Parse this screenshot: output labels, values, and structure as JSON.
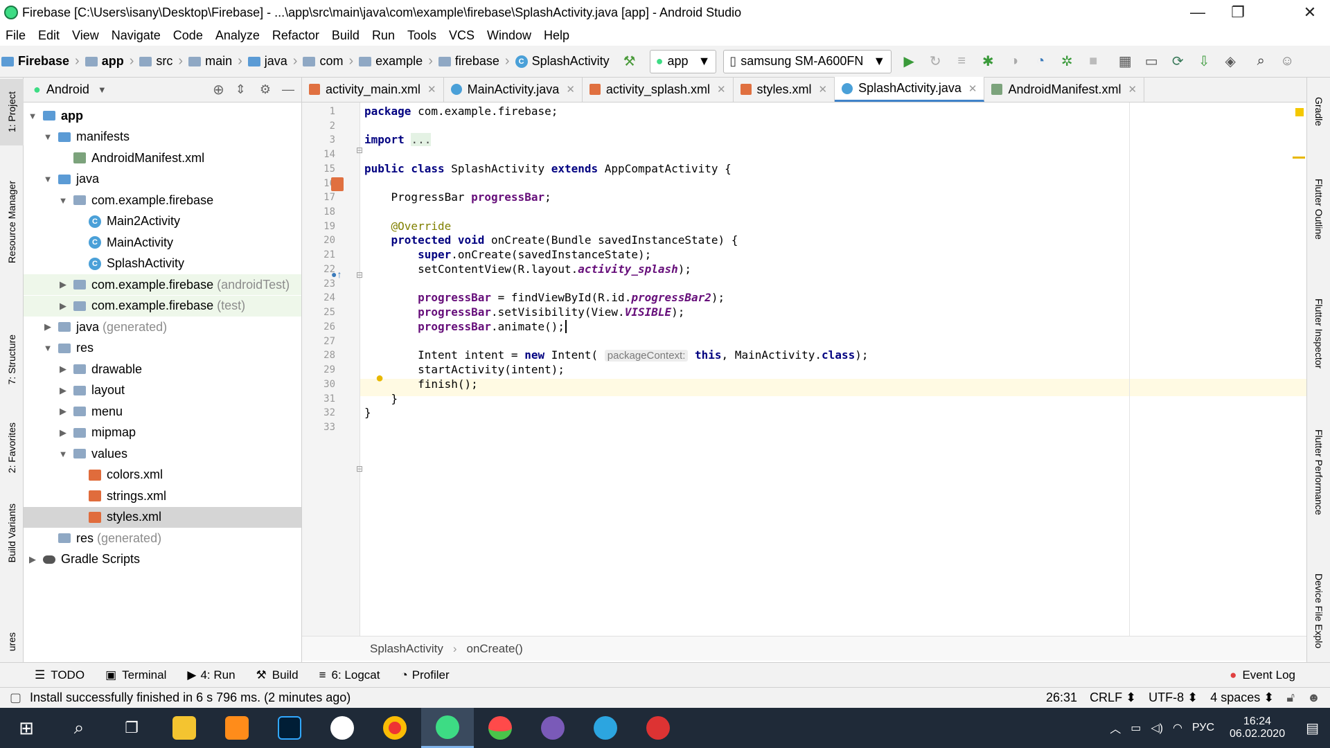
{
  "window": {
    "title": "Firebase [C:\\Users\\isany\\Desktop\\Firebase] - ...\\app\\src\\main\\java\\com\\example\\firebase\\SplashActivity.java [app] - Android Studio",
    "minimize": "—",
    "restore": "❐",
    "close": "✕"
  },
  "menu": [
    "File",
    "Edit",
    "View",
    "Navigate",
    "Code",
    "Analyze",
    "Refactor",
    "Build",
    "Run",
    "Tools",
    "VCS",
    "Window",
    "Help"
  ],
  "breadcrumbs": [
    "Firebase",
    "app",
    "src",
    "main",
    "java",
    "com",
    "example",
    "firebase",
    "SplashActivity"
  ],
  "run_config": "app",
  "device": "samsung SM-A600FN",
  "left_tabs": [
    "1: Project",
    "Resource Manager",
    "7: Structure",
    "2: Favorites",
    "Build Variants",
    "ures"
  ],
  "right_tabs": [
    "Gradle",
    "Flutter Outline",
    "Flutter Inspector",
    "Flutter Performance",
    "Device File Explo"
  ],
  "project_view": "Android",
  "tree": [
    {
      "label": "app",
      "depth": 0,
      "exp": "▼",
      "icon": "fb",
      "bold": true
    },
    {
      "label": "manifests",
      "depth": 1,
      "exp": "▼",
      "icon": "fb"
    },
    {
      "label": "AndroidManifest.xml",
      "depth": 2,
      "exp": "",
      "icon": "mf"
    },
    {
      "label": "java",
      "depth": 1,
      "exp": "▼",
      "icon": "fb"
    },
    {
      "label": "com.example.firebase",
      "depth": 2,
      "exp": "▼",
      "icon": "f"
    },
    {
      "label": "Main2Activity",
      "depth": 3,
      "exp": "",
      "icon": "c"
    },
    {
      "label": "MainActivity",
      "depth": 3,
      "exp": "",
      "icon": "c"
    },
    {
      "label": "SplashActivity",
      "depth": 3,
      "exp": "",
      "icon": "c"
    },
    {
      "label": "com.example.firebase",
      "suffix": "(androidTest)",
      "depth": 2,
      "exp": "▶",
      "icon": "f",
      "green": true
    },
    {
      "label": "com.example.firebase",
      "suffix": "(test)",
      "depth": 2,
      "exp": "▶",
      "icon": "f",
      "green": true
    },
    {
      "label": "java",
      "suffix": "(generated)",
      "depth": 1,
      "exp": "▶",
      "icon": "f"
    },
    {
      "label": "res",
      "depth": 1,
      "exp": "▼",
      "icon": "f"
    },
    {
      "label": "drawable",
      "depth": 2,
      "exp": "▶",
      "icon": "f"
    },
    {
      "label": "layout",
      "depth": 2,
      "exp": "▶",
      "icon": "f"
    },
    {
      "label": "menu",
      "depth": 2,
      "exp": "▶",
      "icon": "f"
    },
    {
      "label": "mipmap",
      "depth": 2,
      "exp": "▶",
      "icon": "f"
    },
    {
      "label": "values",
      "depth": 2,
      "exp": "▼",
      "icon": "f"
    },
    {
      "label": "colors.xml",
      "depth": 3,
      "exp": "",
      "icon": "x"
    },
    {
      "label": "strings.xml",
      "depth": 3,
      "exp": "",
      "icon": "x"
    },
    {
      "label": "styles.xml",
      "depth": 3,
      "exp": "",
      "icon": "x",
      "selected": true
    },
    {
      "label": "res",
      "suffix": "(generated)",
      "depth": 1,
      "exp": "",
      "icon": "f"
    },
    {
      "label": "Gradle Scripts",
      "depth": 0,
      "exp": "▶",
      "icon": "g"
    }
  ],
  "tabs": [
    {
      "label": "activity_main.xml",
      "icon": "xml"
    },
    {
      "label": "MainActivity.java",
      "icon": "class"
    },
    {
      "label": "activity_splash.xml",
      "icon": "xml"
    },
    {
      "label": "styles.xml",
      "icon": "xml"
    },
    {
      "label": "SplashActivity.java",
      "icon": "class",
      "active": true
    },
    {
      "label": "AndroidManifest.xml",
      "icon": "manifest"
    }
  ],
  "tab_close": "✕",
  "line_numbers": [
    "1",
    "2",
    "3",
    "14",
    "15",
    "16",
    "17",
    "18",
    "19",
    "20",
    "21",
    "22",
    "23",
    "24",
    "25",
    "26",
    "27",
    "28",
    "29",
    "30",
    "31",
    "32",
    "33"
  ],
  "code": {
    "l1a": "package",
    "l1b": " com.example.firebase;",
    "l3a": "import",
    "l3b": "...",
    "l15a": "public class",
    "l15b": " SplashActivity ",
    "l15c": "extends",
    "l15d": " AppCompatActivity {",
    "l17a": "    ProgressBar ",
    "l17b": "progressBar",
    "l17c": ";",
    "l19": "    @Override",
    "l20a": "    protected void",
    "l20b": " onCreate(Bundle savedInstanceState) {",
    "l21a": "        super",
    "l21b": ".onCreate(savedInstanceState);",
    "l22a": "        setContentView(R.layout.",
    "l22b": "activity_splash",
    "l22c": ");",
    "l24a": "        progressBar",
    "l24b": " = findViewById(R.id.",
    "l24c": "progressBar2",
    "l24d": ");",
    "l25a": "        progressBar",
    "l25b": ".setVisibility(View.",
    "l25c": "VISIBLE",
    "l25d": ");",
    "l26a": "        progressBar",
    "l26b": ".animate();",
    "l28a": "        Intent intent = ",
    "l28b": "new",
    "l28c": " Intent( ",
    "l28hint": "packageContext:",
    "l28d": " this",
    "l28e": ", MainActivity.",
    "l28f": "class",
    "l28g": ");",
    "l29": "        startActivity(intent);",
    "l30": "        finish();",
    "l31": "    }",
    "l32": "}"
  },
  "editor_breadcrumb": [
    "SplashActivity",
    "onCreate()"
  ],
  "tool_tabs": [
    "TODO",
    "Terminal",
    "4: Run",
    "Build",
    "6: Logcat",
    "Profiler"
  ],
  "event_log": "Event Log",
  "status_message": "Install successfully finished in 6 s 796 ms. (2 minutes ago)",
  "status_right": [
    "26:31",
    "CRLF ⬍",
    "UTF-8 ⬍",
    "4 spaces ⬍"
  ],
  "clock": {
    "time": "16:24",
    "date": "06.02.2020"
  },
  "lang": "РУС"
}
